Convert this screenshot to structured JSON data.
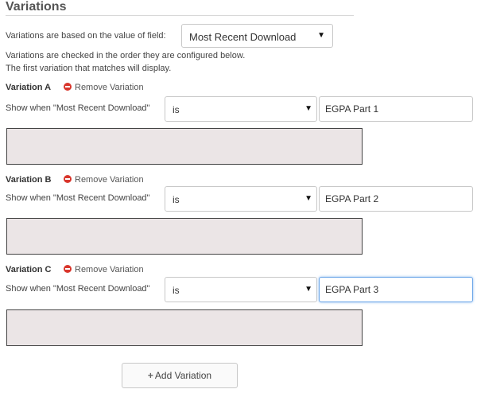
{
  "section": {
    "title": "Variations",
    "based_on_label": "Variations are based on the value of field:",
    "field_selected": "Most Recent Download",
    "info_line_1": "Variations are checked in the order they are configured below.",
    "info_line_2": "The first variation that matches will display."
  },
  "variations": [
    {
      "title": "Variation A",
      "remove_label": "Remove Variation",
      "show_when_label": "Show when \"Most Recent Download\"",
      "operator": "is",
      "value": "EGPA Part 1"
    },
    {
      "title": "Variation B",
      "remove_label": "Remove Variation",
      "show_when_label": "Show when \"Most Recent Download\"",
      "operator": "is",
      "value": "EGPA Part 2"
    },
    {
      "title": "Variation C",
      "remove_label": "Remove Variation",
      "show_when_label": "Show when \"Most Recent Download\"",
      "operator": "is",
      "value": "EGPA Part 3"
    }
  ],
  "add_button": {
    "icon": "plus-icon",
    "label": "Add Variation"
  },
  "icons": {
    "remove": "minus-circle-icon",
    "dropdown": "caret-down-icon"
  },
  "colors": {
    "remove_icon": "#d9362c",
    "content_box_bg": "#ebe5e6",
    "focus_border": "#6aa5e8"
  }
}
